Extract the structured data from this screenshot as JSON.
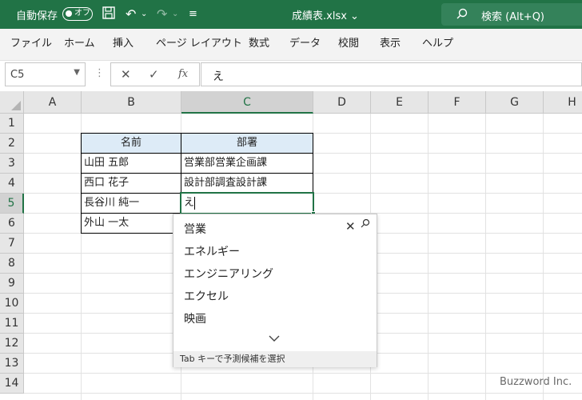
{
  "titlebar": {
    "autosave_label": "自動保存",
    "autosave_state": "オフ",
    "filename": "成績表.xlsx",
    "search_label": "検索 (Alt+Q)",
    "bg_color": "#217346"
  },
  "menu": {
    "items": [
      "ファイル",
      "ホーム",
      "挿入",
      "ページ レイアウト",
      "数式",
      "データ",
      "校閲",
      "表示",
      "ヘルプ"
    ]
  },
  "formula_bar": {
    "name_box": "C5",
    "cancel_icon": "✕",
    "enter_icon": "✓",
    "fx_label": "fx",
    "content": "え"
  },
  "sheet": {
    "columns": [
      "A",
      "B",
      "C",
      "D",
      "E",
      "F",
      "G",
      "H"
    ],
    "rows": [
      "1",
      "2",
      "3",
      "4",
      "5",
      "6",
      "7",
      "8",
      "9",
      "10",
      "11",
      "12",
      "13",
      "14"
    ],
    "selected_cell": "C5",
    "header_fill": "#ddebf7",
    "table": {
      "headers": [
        "名前",
        "部署"
      ],
      "rows": [
        [
          "山田 五郎",
          "営業部営業企画課"
        ],
        [
          "西口 花子",
          "設計部調査設計課"
        ],
        [
          "長谷川 純一",
          "え"
        ],
        [
          "外山 一太",
          ""
        ]
      ]
    }
  },
  "autocomplete": {
    "items": [
      "営業",
      "エネルギー",
      "エンジニアリング",
      "エクセル",
      "映画"
    ],
    "footer": "Tab キーで予測候補を選択"
  },
  "watermark": "Buzzword Inc."
}
